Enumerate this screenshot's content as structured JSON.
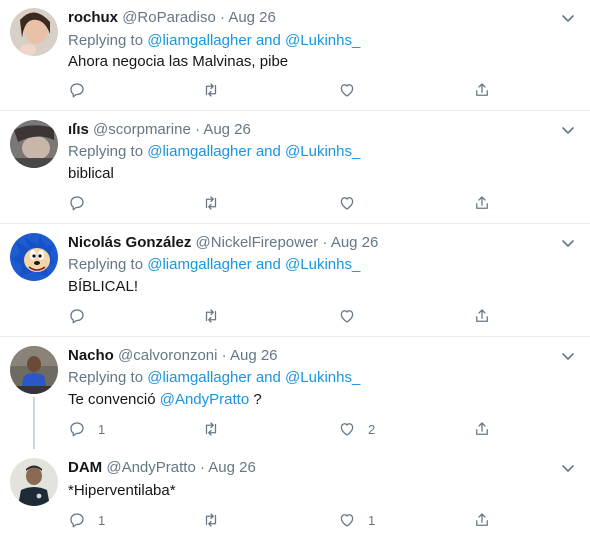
{
  "tweets": [
    {
      "name": "rochux",
      "handle": "@RoParadiso",
      "dot": "·",
      "time": "Aug 26",
      "replying_prefix": "Replying to",
      "mention1": "@liamgallagher",
      "and_word": "and",
      "mention2": "@Lukinhs_",
      "text": "Ahora negocia las Malvinas, pibe",
      "replies": "",
      "retweets": "",
      "likes": ""
    },
    {
      "name": "ıſıs",
      "handle": "@scorpmarine",
      "dot": "·",
      "time": "Aug 26",
      "replying_prefix": "Replying to",
      "mention1": "@liamgallagher",
      "and_word": "and",
      "mention2": "@Lukinhs_",
      "text": "biblical",
      "replies": "",
      "retweets": "",
      "likes": ""
    },
    {
      "name": "Nicolás González",
      "handle": "@NickelFirepower",
      "dot": "·",
      "time": "Aug 26",
      "replying_prefix": "Replying to",
      "mention1": "@liamgallagher",
      "and_word": "and",
      "mention2": "@Lukinhs_",
      "text": "BÍBLICAL!",
      "replies": "",
      "retweets": "",
      "likes": ""
    },
    {
      "name": "Nacho",
      "handle": "@calvoronzoni",
      "dot": "·",
      "time": "Aug 26",
      "replying_prefix": "Replying to",
      "mention1": "@liamgallagher",
      "and_word": "and",
      "mention2": "@Lukinhs_",
      "text_before": "Te convenció",
      "text_mention": "@AndyPratto",
      "text_after": "?",
      "replies": "1",
      "retweets": "",
      "likes": "2"
    },
    {
      "name": "DAM",
      "handle": "@AndyPratto",
      "dot": "·",
      "time": "Aug 26",
      "text": "*Hiperventilaba*",
      "replies": "1",
      "retweets": "",
      "likes": "1"
    }
  ],
  "icons": {
    "reply": "reply-icon",
    "retweet": "retweet-icon",
    "like": "like-icon",
    "share": "share-icon",
    "more": "chevron-down-icon"
  },
  "colors": {
    "link": "#1b95e0",
    "muted": "#657786",
    "separator": "#e6ecf0",
    "thread_line": "#ccd6dd"
  }
}
